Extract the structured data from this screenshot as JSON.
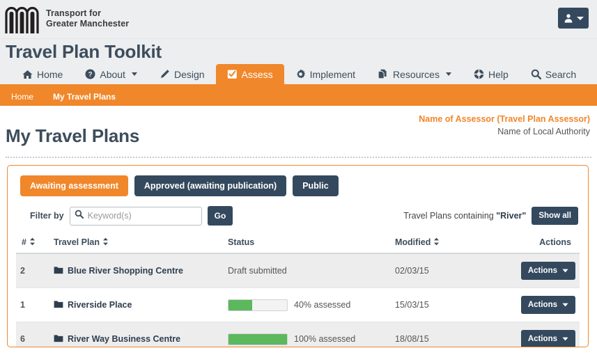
{
  "brand": {
    "logo_icon": "tfgm-logo-icon",
    "line1": "Transport for",
    "line2": "Greater Manchester",
    "orange": "#f0872a",
    "slate": "#34495e",
    "green": "#5cb85c"
  },
  "header": {
    "user_menu_icon": "user-icon",
    "user_menu_caret": "caret-down-icon"
  },
  "site": {
    "title": "Travel Plan Toolkit"
  },
  "nav": {
    "items": [
      {
        "label": "Home",
        "icon": "home-icon",
        "active": false,
        "caret": false
      },
      {
        "label": "About",
        "icon": "question-circle-icon",
        "active": false,
        "caret": true
      },
      {
        "label": "Design",
        "icon": "pencil-icon",
        "active": false,
        "caret": false
      },
      {
        "label": "Assess",
        "icon": "check-square-icon",
        "active": true,
        "caret": false
      },
      {
        "label": "Implement",
        "icon": "gear-icon",
        "active": false,
        "caret": false
      },
      {
        "label": "Resources",
        "icon": "copy-files-icon",
        "active": false,
        "caret": true
      },
      {
        "label": "Help",
        "icon": "lifebuoy-icon",
        "active": false,
        "caret": false
      },
      {
        "label": "Search",
        "icon": "search-icon",
        "active": false,
        "caret": false
      }
    ]
  },
  "breadcrumb": {
    "items": [
      "Home",
      "My Travel Plans"
    ]
  },
  "page": {
    "title": "My Travel Plans",
    "assessor": "Name of Assessor (Travel Plan Assessor)",
    "authority": "Name of Local Authority"
  },
  "tabs": [
    {
      "label": "Awaiting assessment",
      "active": true
    },
    {
      "label": "Approved (awaiting publication)",
      "active": false
    },
    {
      "label": "Public",
      "active": false
    }
  ],
  "filter": {
    "label": "Filter by",
    "search_icon": "search-icon",
    "value": "",
    "placeholder": "Keyword(s)",
    "go_label": "Go",
    "containing_prefix": "Travel Plans containing ",
    "containing_term": "\"River\"",
    "show_all_label": "Show all"
  },
  "table": {
    "columns": [
      {
        "label": "#",
        "sortable": true
      },
      {
        "label": "Travel Plan",
        "sortable": true
      },
      {
        "label": "Status",
        "sortable": false
      },
      {
        "label": "Modified",
        "sortable": true
      },
      {
        "label": "Actions",
        "sortable": false
      }
    ],
    "rows": [
      {
        "num": "2",
        "name": "Blue River Shopping Centre",
        "icon": "folder-icon",
        "status_text": "Draft submitted",
        "has_progress": false,
        "progress": 0,
        "modified": "02/03/15",
        "action_label": "Actions"
      },
      {
        "num": "1",
        "name": "Riverside Place",
        "icon": "folder-icon",
        "status_text": "40% assessed",
        "has_progress": true,
        "progress": 40,
        "modified": "15/03/15",
        "action_label": "Actions"
      },
      {
        "num": "6",
        "name": "River Way Business Centre",
        "icon": "folder-icon",
        "status_text": "100% assessed",
        "has_progress": true,
        "progress": 100,
        "modified": "18/08/15",
        "action_label": "Actions"
      }
    ]
  }
}
